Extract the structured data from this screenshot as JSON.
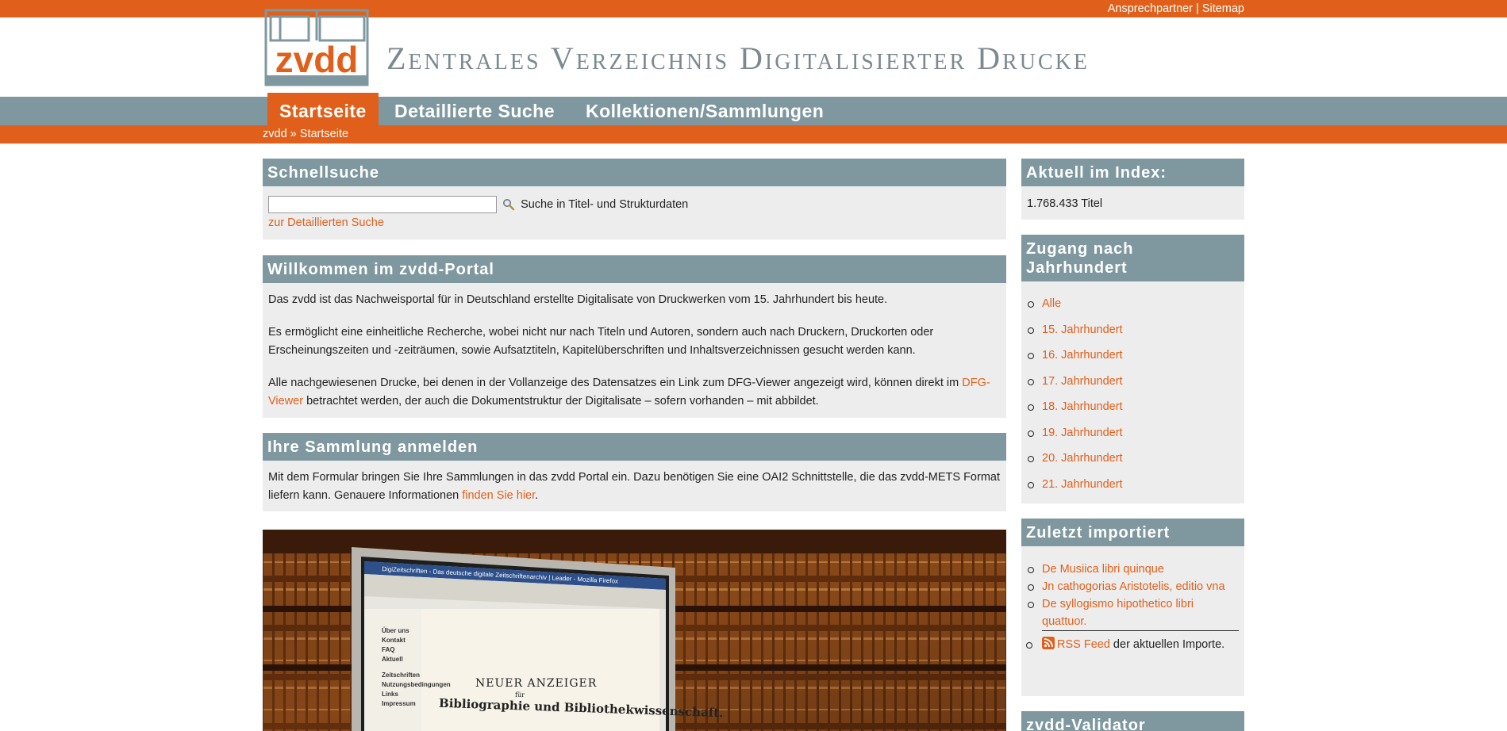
{
  "header": {
    "links": [
      "Ansprechpartner",
      "Sitemap"
    ],
    "separator": "|",
    "logo_text": "zvdd",
    "site_title": "Zentrales Verzeichnis Digitalisierter Drucke"
  },
  "nav": {
    "items": [
      "Startseite",
      "Detaillierte Suche",
      "Kollektionen/Sammlungen"
    ]
  },
  "breadcrumb": {
    "root": "zvdd",
    "sep": "»",
    "current": "Startseite"
  },
  "quicksearch": {
    "title": "Schnellsuche",
    "input_value": "",
    "hint": "Suche in Titel- und Strukturdaten",
    "detail_link": "zur Detaillierten Suche"
  },
  "welcome": {
    "title": "Willkommen im zvdd-Portal",
    "p1": "Das zvdd ist das Nachweisportal für in Deutschland erstellte Digitalisate von Druckwerken vom 15. Jahrhundert bis heute.",
    "p2": "Es ermöglicht eine einheitliche Recherche, wobei nicht nur nach Titeln und Autoren, sondern auch nach Druckern, Druckorten oder Erscheinungszeiten und -zeiträumen, sowie Aufsatztiteln, Kapitelüberschriften und Inhaltsverzeichnissen gesucht werden kann.",
    "p3_pre": "Alle nachgewiesenen Drucke, bei denen in der Vollanzeige des Datensatzes ein Link zum DFG-Viewer angezeigt wird, können direkt im ",
    "p3_link": "DFG-Viewer",
    "p3_post": " betrachtet werden, der auch die Dokumentstruktur der Digitalisate – sofern vorhanden – mit abbildet."
  },
  "register": {
    "title": "Ihre Sammlung anmelden",
    "text_pre": "Mit dem Formular bringen Sie Ihre Sammlungen in das zvdd Portal ein. Dazu benötigen Sie eine OAI2 Schnittstelle, die das zvdd-METS Format liefern kann. Genauere Informationen ",
    "link": "finden Sie hier",
    "text_post": "."
  },
  "photo": {
    "window_title": "DigiZeitschriften - Das deutsche digitale Zeitschriftenarchiv | Leader - Mozilla Firefox",
    "menu": [
      "Über uns",
      "Kontakt",
      "FAQ",
      "Aktuell",
      "Zeitschriften",
      "Nutzungsbedingungen",
      "Links",
      "Impressum"
    ],
    "doc_line1": "NEUER ANZEIGER",
    "doc_line2": "für",
    "doc_line3": "Bibliographie und Bibliothekwissenschaft."
  },
  "index": {
    "title": "Aktuell im Index:",
    "count": "1.768.433 Titel"
  },
  "century": {
    "title": "Zugang nach Jahrhundert",
    "items": [
      "Alle",
      "15. Jahrhundert",
      "16. Jahrhundert",
      "17. Jahrhundert",
      "18. Jahrhundert",
      "19. Jahrhundert",
      "20. Jahrhundert",
      "21. Jahrhundert"
    ]
  },
  "recent": {
    "title": "Zuletzt importiert",
    "items": [
      "De Musiica libri quinque",
      "Jn cathogorias Aristotelis, editio vna",
      "De syllogismo hipothetico libri quattuor."
    ],
    "rss_link": "RSS Feed",
    "rss_text": " der aktuellen Importe."
  },
  "validator": {
    "title": "zvdd-Validator"
  },
  "colors": {
    "accent": "#e0601b",
    "nav": "#7f98a0",
    "panel": "#ededed"
  }
}
